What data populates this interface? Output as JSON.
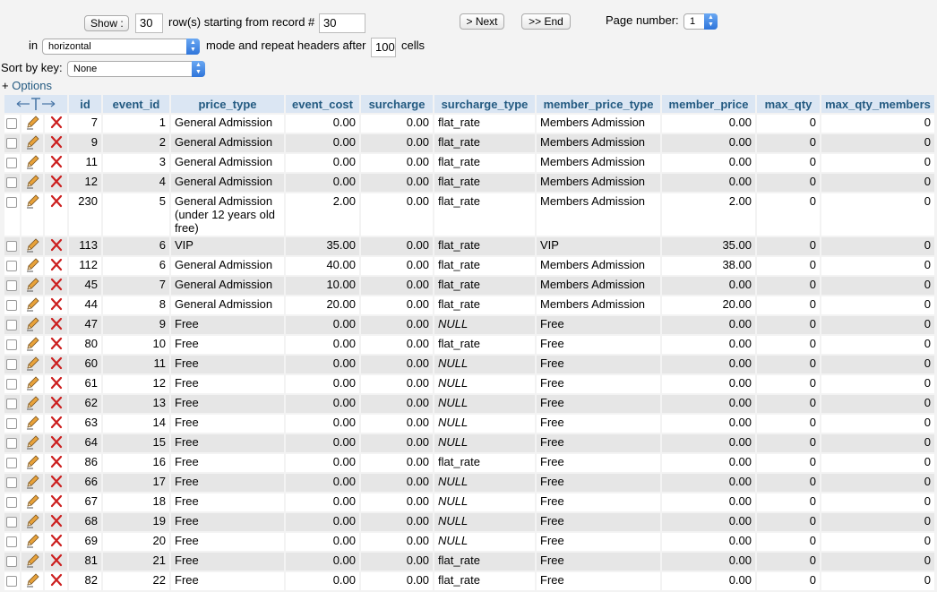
{
  "nav": {
    "show_label": "Show :",
    "rows_value": "30",
    "rows_text": "row(s) starting from record #",
    "start_value": "30",
    "next_label": "> Next",
    "end_label": ">> End",
    "page_number_label": "Page number:",
    "page_number_value": "1",
    "in_label": "in",
    "mode_value": "horizontal",
    "mode_text": "mode and repeat headers after",
    "repeat_value": "100",
    "cells_text": "cells",
    "sort_label": "Sort by key:",
    "sort_value": "None",
    "options_prefix": "+",
    "options_label": "Options"
  },
  "table": {
    "columns": [
      "id",
      "event_id",
      "price_type",
      "event_cost",
      "surcharge",
      "surcharge_type",
      "member_price_type",
      "member_price",
      "max_qty",
      "max_qty_members"
    ],
    "rows": [
      [
        "7",
        "1",
        "General Admission",
        "0.00",
        "0.00",
        "flat_rate",
        "Members Admission",
        "0.00",
        "0",
        "0"
      ],
      [
        "9",
        "2",
        "General Admission",
        "0.00",
        "0.00",
        "flat_rate",
        "Members Admission",
        "0.00",
        "0",
        "0"
      ],
      [
        "11",
        "3",
        "General Admission",
        "0.00",
        "0.00",
        "flat_rate",
        "Members Admission",
        "0.00",
        "0",
        "0"
      ],
      [
        "12",
        "4",
        "General Admission",
        "0.00",
        "0.00",
        "flat_rate",
        "Members Admission",
        "0.00",
        "0",
        "0"
      ],
      [
        "230",
        "5",
        "General Admission (under 12 years old free)",
        "2.00",
        "0.00",
        "flat_rate",
        "Members Admission",
        "2.00",
        "0",
        "0"
      ],
      [
        "113",
        "6",
        "VIP",
        "35.00",
        "0.00",
        "flat_rate",
        "VIP",
        "35.00",
        "0",
        "0"
      ],
      [
        "112",
        "6",
        "General Admission",
        "40.00",
        "0.00",
        "flat_rate",
        "Members Admission",
        "38.00",
        "0",
        "0"
      ],
      [
        "45",
        "7",
        "General Admission",
        "10.00",
        "0.00",
        "flat_rate",
        "Members Admission",
        "0.00",
        "0",
        "0"
      ],
      [
        "44",
        "8",
        "General Admission",
        "20.00",
        "0.00",
        "flat_rate",
        "Members Admission",
        "20.00",
        "0",
        "0"
      ],
      [
        "47",
        "9",
        "Free",
        "0.00",
        "0.00",
        "NULL",
        "Free",
        "0.00",
        "0",
        "0"
      ],
      [
        "80",
        "10",
        "Free",
        "0.00",
        "0.00",
        "flat_rate",
        "Free",
        "0.00",
        "0",
        "0"
      ],
      [
        "60",
        "11",
        "Free",
        "0.00",
        "0.00",
        "NULL",
        "Free",
        "0.00",
        "0",
        "0"
      ],
      [
        "61",
        "12",
        "Free",
        "0.00",
        "0.00",
        "NULL",
        "Free",
        "0.00",
        "0",
        "0"
      ],
      [
        "62",
        "13",
        "Free",
        "0.00",
        "0.00",
        "NULL",
        "Free",
        "0.00",
        "0",
        "0"
      ],
      [
        "63",
        "14",
        "Free",
        "0.00",
        "0.00",
        "NULL",
        "Free",
        "0.00",
        "0",
        "0"
      ],
      [
        "64",
        "15",
        "Free",
        "0.00",
        "0.00",
        "NULL",
        "Free",
        "0.00",
        "0",
        "0"
      ],
      [
        "86",
        "16",
        "Free",
        "0.00",
        "0.00",
        "flat_rate",
        "Free",
        "0.00",
        "0",
        "0"
      ],
      [
        "66",
        "17",
        "Free",
        "0.00",
        "0.00",
        "NULL",
        "Free",
        "0.00",
        "0",
        "0"
      ],
      [
        "67",
        "18",
        "Free",
        "0.00",
        "0.00",
        "NULL",
        "Free",
        "0.00",
        "0",
        "0"
      ],
      [
        "68",
        "19",
        "Free",
        "0.00",
        "0.00",
        "NULL",
        "Free",
        "0.00",
        "0",
        "0"
      ],
      [
        "69",
        "20",
        "Free",
        "0.00",
        "0.00",
        "NULL",
        "Free",
        "0.00",
        "0",
        "0"
      ],
      [
        "81",
        "21",
        "Free",
        "0.00",
        "0.00",
        "flat_rate",
        "Free",
        "0.00",
        "0",
        "0"
      ],
      [
        "82",
        "22",
        "Free",
        "0.00",
        "0.00",
        "flat_rate",
        "Free",
        "0.00",
        "0",
        "0"
      ]
    ]
  },
  "icons": {
    "edit": "pencil-icon",
    "delete": "delete-x-icon",
    "header": "column-arrows-icon"
  }
}
